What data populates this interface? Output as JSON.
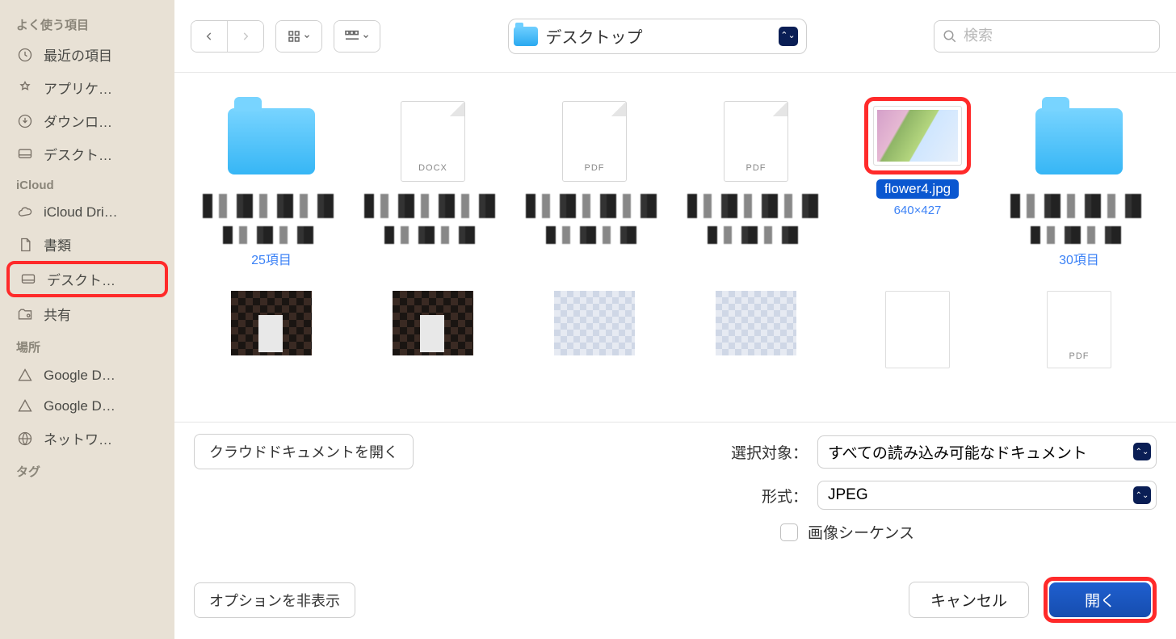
{
  "sidebar": {
    "sections": [
      {
        "header": "よく使う項目",
        "items": [
          {
            "icon": "clock",
            "label": "最近の項目"
          },
          {
            "icon": "apps",
            "label": "アプリケ…"
          },
          {
            "icon": "download",
            "label": "ダウンロ…"
          },
          {
            "icon": "desktop",
            "label": "デスクト…"
          }
        ]
      },
      {
        "header": "iCloud",
        "items": [
          {
            "icon": "cloud",
            "label": "iCloud Dri…"
          },
          {
            "icon": "doc",
            "label": "書類"
          },
          {
            "icon": "desktop",
            "label": "デスクト…",
            "highlighted": true
          },
          {
            "icon": "shared",
            "label": "共有"
          }
        ]
      },
      {
        "header": "場所",
        "items": [
          {
            "icon": "disk",
            "label": "Google D…"
          },
          {
            "icon": "disk",
            "label": "Google D…"
          },
          {
            "icon": "globe",
            "label": "ネットワ…"
          }
        ]
      },
      {
        "header": "タグ",
        "items": []
      }
    ]
  },
  "toolbar": {
    "path_label": "デスクトップ",
    "search_placeholder": "検索"
  },
  "files": {
    "row1": [
      {
        "type": "folder",
        "caption": "25項目"
      },
      {
        "type": "doc",
        "badge": "DOCX"
      },
      {
        "type": "doc",
        "badge": "PDF"
      },
      {
        "type": "doc",
        "badge": "PDF"
      },
      {
        "type": "image",
        "name": "flower4.jpg",
        "dims": "640×427",
        "selected": true
      },
      {
        "type": "folder",
        "caption": "30項目"
      }
    ]
  },
  "options": {
    "cloud_button": "クラウドドキュメントを開く",
    "target_label": "選択対象：",
    "target_value": "すべての読み込み可能なドキュメント",
    "format_label": "形式：",
    "format_value": "JPEG",
    "sequence_label": "画像シーケンス"
  },
  "footer": {
    "hide_options": "オプションを非表示",
    "cancel": "キャンセル",
    "open": "開く"
  }
}
